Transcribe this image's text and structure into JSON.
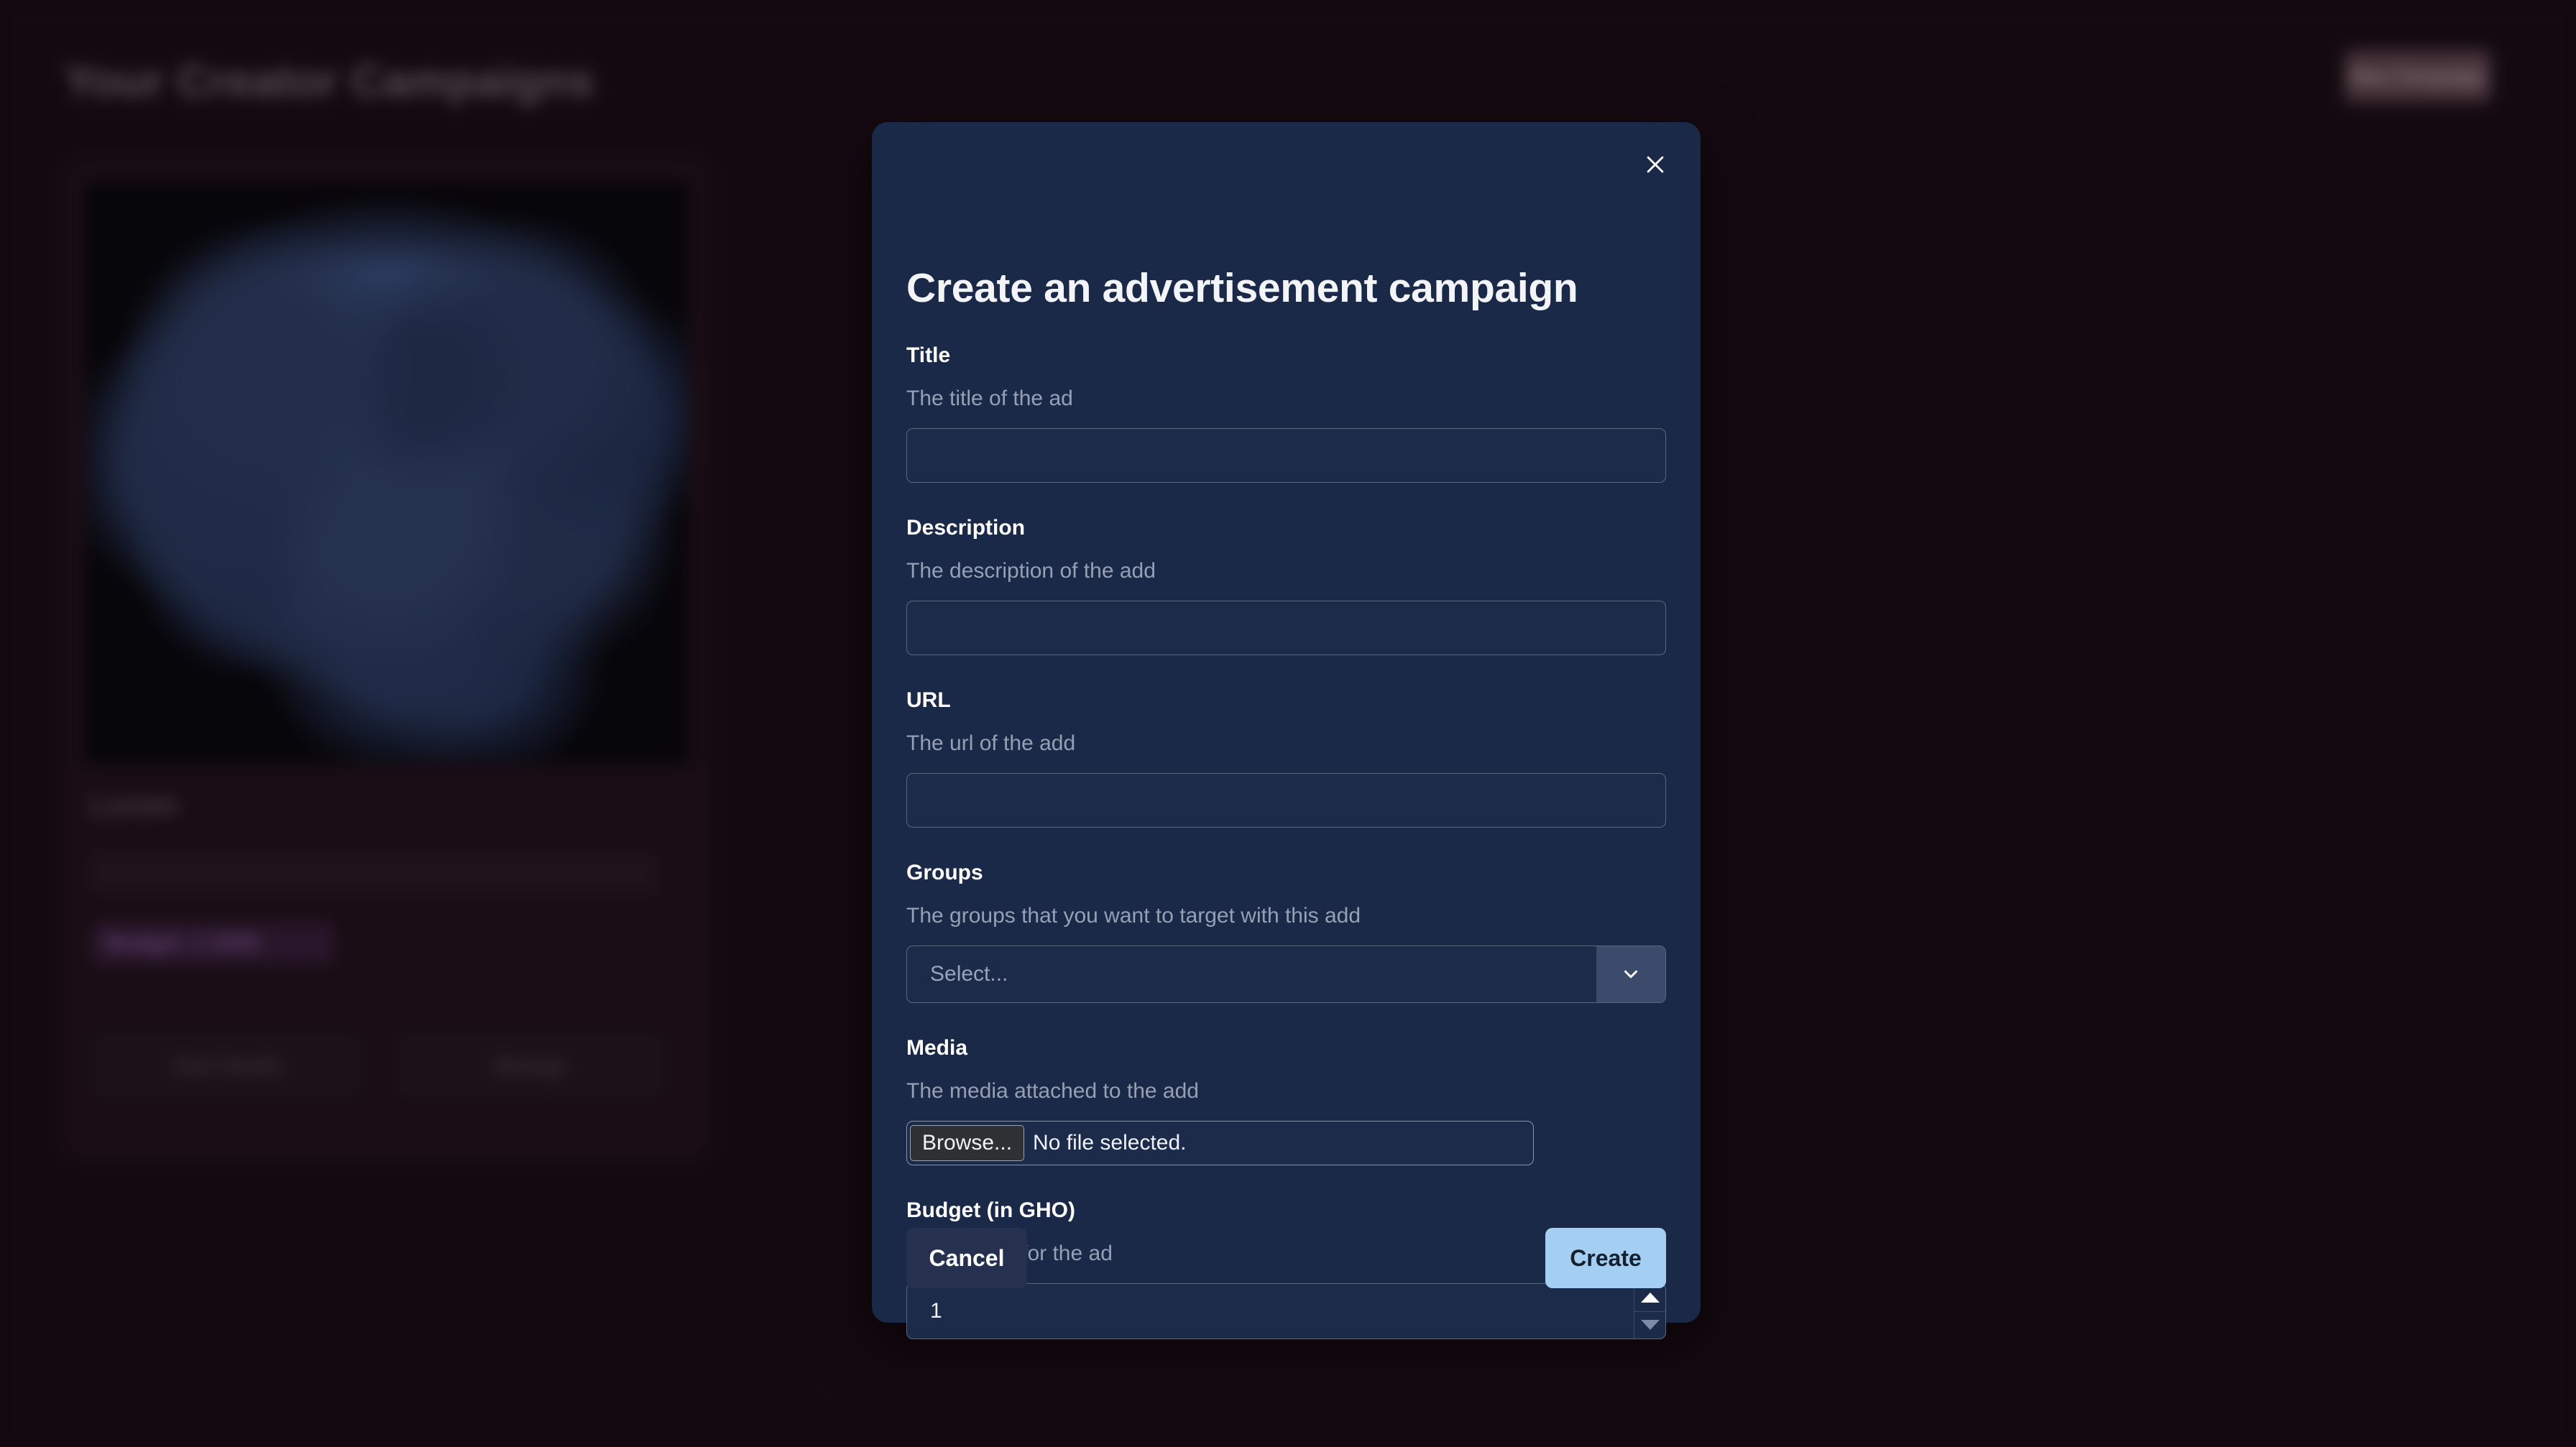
{
  "page": {
    "heading": "Your Creator Campaigns",
    "new_campaign_button": "New Campaign",
    "card": {
      "title": "Lorem",
      "description": "",
      "budget_badge": "Budget: 1 GHO",
      "action_left": "View Details",
      "action_right": "Manage"
    },
    "background_color": "#180a12",
    "accent_color": "#a5cff2"
  },
  "modal": {
    "title": "Create an advertisement campaign",
    "close_label": "Close",
    "fields": [
      {
        "key": "title",
        "label": "Title",
        "hint": "The title of the ad",
        "value": "",
        "placeholder": ""
      },
      {
        "key": "description",
        "label": "Description",
        "hint": "The description of the add",
        "value": "",
        "placeholder": ""
      },
      {
        "key": "url",
        "label": "URL",
        "hint": "The url of the add",
        "value": "",
        "placeholder": ""
      },
      {
        "key": "groups",
        "label": "Groups",
        "hint": "The groups that you want to target with this add",
        "value": "Select..."
      },
      {
        "key": "media",
        "label": "Media",
        "hint": "The media attached to the add",
        "browse_label": "Browse...",
        "file_name": "No file selected."
      },
      {
        "key": "budget",
        "label": "Budget (in GHO)",
        "hint": "The budget for the ad",
        "value": "1"
      }
    ],
    "footer": {
      "cancel_label": "Cancel",
      "create_label": "Create"
    }
  }
}
